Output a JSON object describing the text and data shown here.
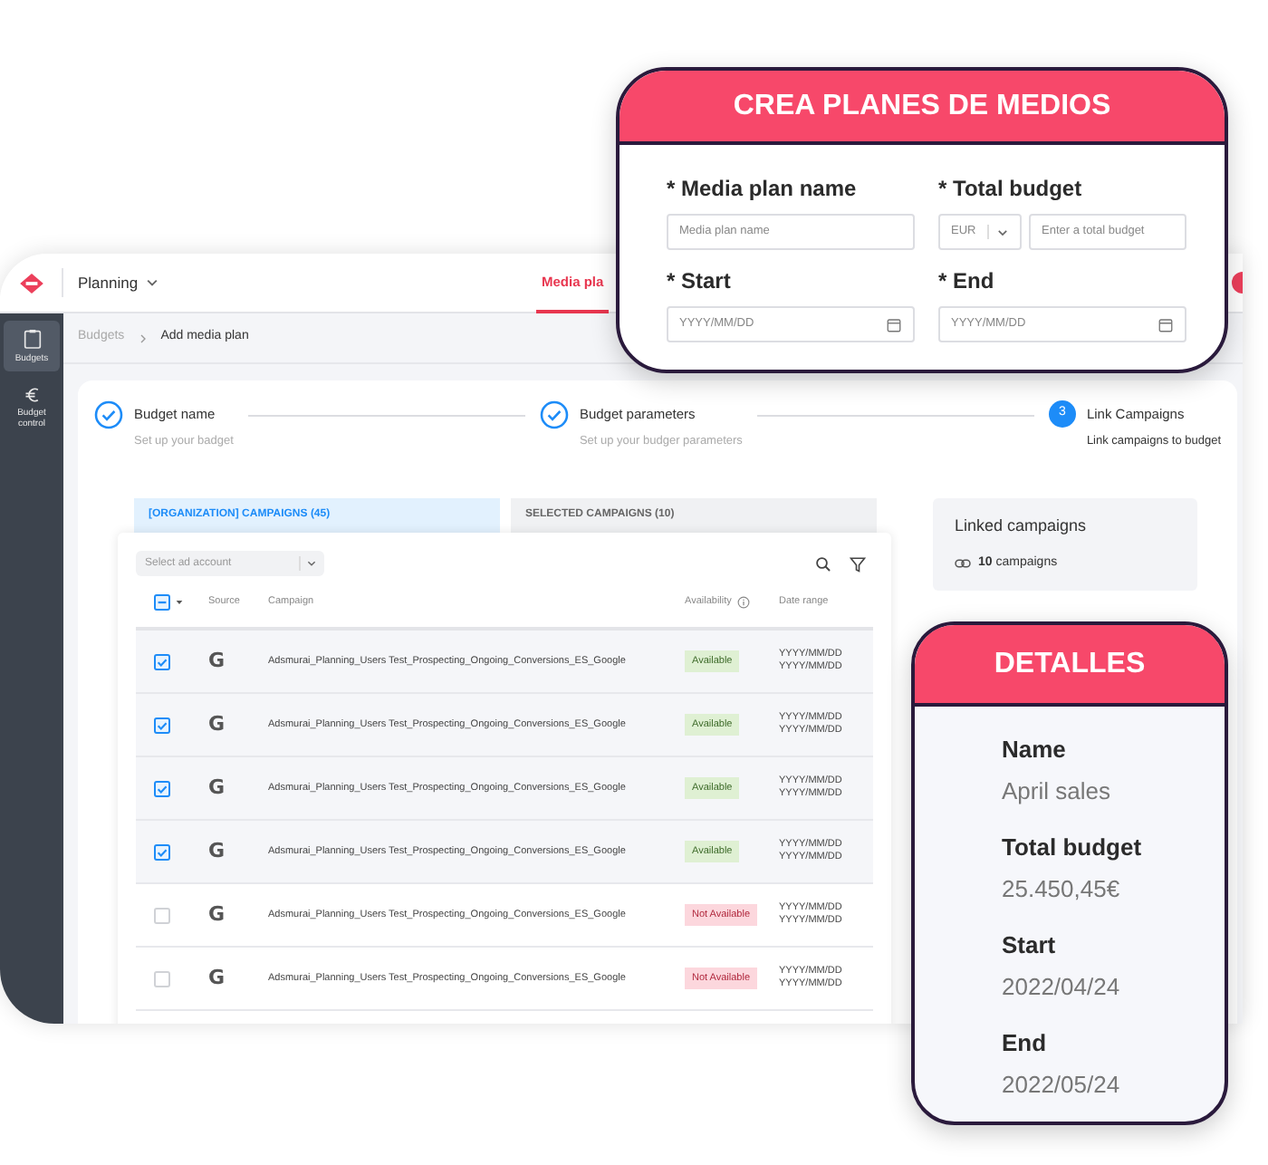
{
  "header": {
    "workspace": "Planning",
    "tabs": [
      {
        "label": "Media pla",
        "selected": true
      }
    ]
  },
  "sidebar": {
    "items": [
      {
        "label": "Budgets",
        "selected": true
      },
      {
        "label": "Budget control",
        "selected": false
      }
    ]
  },
  "breadcrumb": [
    "Budgets",
    "Add media plan"
  ],
  "steps": [
    {
      "title": "Budget name",
      "subtitle": "Set up your badget",
      "completed": true
    },
    {
      "title": "Budget parameters",
      "subtitle": "Set up your budger parameters",
      "completed": true
    },
    {
      "title": "Link Campaigns",
      "subtitle": "Link campaigns to budget",
      "completed": false,
      "number": "3"
    }
  ],
  "campaign_tabs": [
    {
      "label": "[ORGANIZATION] CAMPAIGNS (45)",
      "selected": true
    },
    {
      "label": "SELECTED CAMPAIGNS (10)",
      "selected": false
    }
  ],
  "table": {
    "account_select": {
      "placeholder": "Select ad account"
    },
    "header_checkbox": {
      "indeterminate": true
    },
    "columns": [
      "Source",
      "Campaign",
      "Availability",
      "Date range"
    ],
    "rows": [
      {
        "checked": true,
        "source": "G",
        "campaign": "Adsmurai_Planning_Users Test_Prospecting_Ongoing_Conversions_ES_Google",
        "availability": {
          "label": "Available",
          "kind": "available"
        },
        "dates": [
          "YYYY/MM/DD",
          "YYYY/MM/DD"
        ]
      },
      {
        "checked": true,
        "source": "G",
        "campaign": "Adsmurai_Planning_Users Test_Prospecting_Ongoing_Conversions_ES_Google",
        "availability": {
          "label": "Available",
          "kind": "available"
        },
        "dates": [
          "YYYY/MM/DD",
          "YYYY/MM/DD"
        ]
      },
      {
        "checked": true,
        "source": "G",
        "campaign": "Adsmurai_Planning_Users Test_Prospecting_Ongoing_Conversions_ES_Google",
        "availability": {
          "label": "Available",
          "kind": "available"
        },
        "dates": [
          "YYYY/MM/DD",
          "YYYY/MM/DD"
        ]
      },
      {
        "checked": true,
        "source": "G",
        "campaign": "Adsmurai_Planning_Users Test_Prospecting_Ongoing_Conversions_ES_Google",
        "availability": {
          "label": "Available",
          "kind": "available"
        },
        "dates": [
          "YYYY/MM/DD",
          "YYYY/MM/DD"
        ]
      },
      {
        "checked": false,
        "source": "G",
        "campaign": "Adsmurai_Planning_Users Test_Prospecting_Ongoing_Conversions_ES_Google",
        "availability": {
          "label": "Not Available",
          "kind": "unavailable"
        },
        "dates": [
          "YYYY/MM/DD",
          "YYYY/MM/DD"
        ]
      },
      {
        "checked": false,
        "source": "G",
        "campaign": "Adsmurai_Planning_Users Test_Prospecting_Ongoing_Conversions_ES_Google",
        "availability": {
          "label": "Not Available",
          "kind": "unavailable"
        },
        "dates": [
          "YYYY/MM/DD",
          "YYYY/MM/DD"
        ]
      }
    ]
  },
  "linked": {
    "title": "Linked campaigns",
    "text": "**10** campaigns"
  },
  "create_card": {
    "title": "CREA PLANES DE MEDIOS",
    "fields": [
      {
        "kind": "text",
        "label": "* Media plan name",
        "placeholder": "Media plan name"
      },
      {
        "kind": "money",
        "label": "* Total budget",
        "currency": "EUR",
        "placeholder": "Enter a total budget"
      },
      {
        "kind": "date",
        "label": "* Start",
        "placeholder": "YYYY/MM/DD"
      },
      {
        "kind": "date",
        "label": "* End",
        "placeholder": "YYYY/MM/DD"
      }
    ]
  },
  "details_card": {
    "title": "DETALLES",
    "items": [
      {
        "label": "Name",
        "value": "April sales"
      },
      {
        "label": "Total budget",
        "value": "25.450,45€"
      },
      {
        "label": "Start",
        "value": "2022/04/24"
      },
      {
        "label": "End",
        "value": "2022/05/24"
      }
    ]
  }
}
